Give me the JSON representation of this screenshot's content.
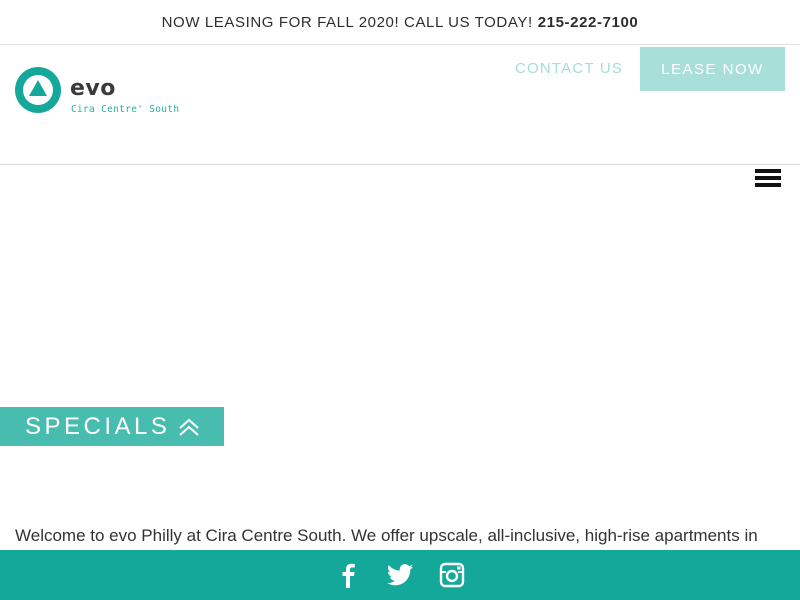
{
  "announcement": {
    "text": "NOW LEASING FOR FALL 2020! CALL US TODAY!",
    "phone": "215-222-7100"
  },
  "logo": {
    "name": "evo",
    "subtitle": "Cira Centre' South"
  },
  "header": {
    "contact_label": "CONTACT US",
    "lease_label": "LEASE NOW"
  },
  "specials": {
    "label": "SPECIALS"
  },
  "main": {
    "welcome_text": "Welcome to evo Philly at Cira Centre South. We offer upscale, all-inclusive, high-rise apartments in"
  },
  "footer": {
    "social": [
      "facebook-icon",
      "twitter-icon",
      "instagram-icon"
    ]
  },
  "colors": {
    "brand_teal": "#14a89a",
    "specials_teal": "#49bcb0",
    "lease_button": "#a8e0d9",
    "contact_text": "#a9dcd5"
  }
}
